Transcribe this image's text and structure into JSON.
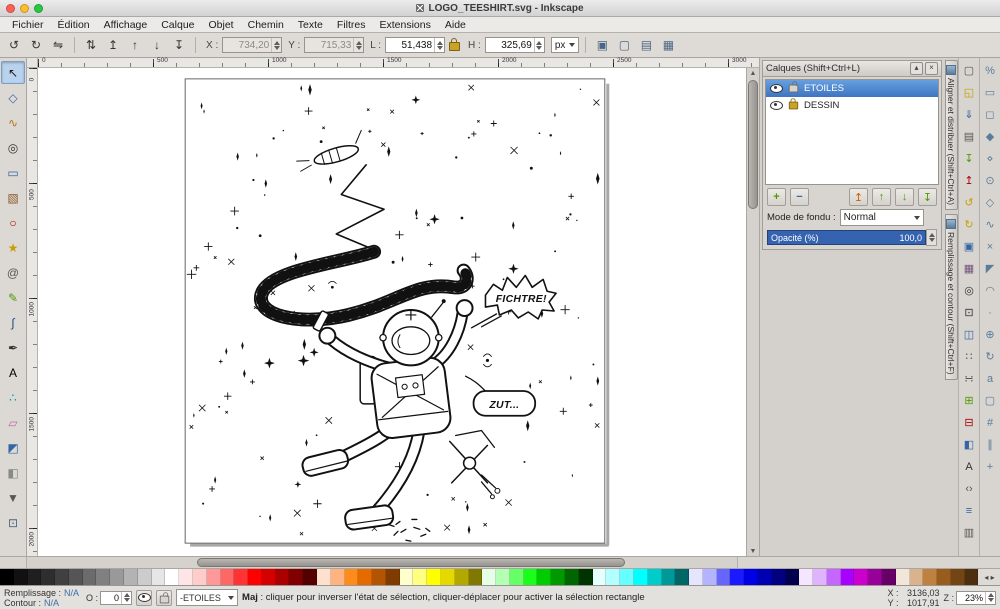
{
  "window": {
    "title": "LOGO_TEESHIRT.svg - Inkscape"
  },
  "menubar": {
    "items": [
      "Fichier",
      "Édition",
      "Affichage",
      "Calque",
      "Objet",
      "Chemin",
      "Texte",
      "Filtres",
      "Extensions",
      "Aide"
    ]
  },
  "tool_options": {
    "history_buttons": [
      {
        "name": "rotate-90-ccw-button",
        "glyph": "↺"
      },
      {
        "name": "rotate-90-cw-button",
        "glyph": "↻"
      },
      {
        "name": "flip-horizontal-button",
        "glyph": "⇋"
      }
    ],
    "arrange_buttons": [
      {
        "name": "flip-vertical-button",
        "glyph": "⇅"
      },
      {
        "name": "raise-to-top-button",
        "glyph": "↥"
      },
      {
        "name": "raise-button",
        "glyph": "↑"
      },
      {
        "name": "lower-button",
        "glyph": "↓"
      },
      {
        "name": "lower-to-bottom-button",
        "glyph": "↧"
      }
    ],
    "x_label": "X :",
    "x_value": "734,20",
    "y_label": "Y :",
    "y_value": "715,33",
    "w_label": "L :",
    "w_value": "51,438",
    "h_label": "H :",
    "h_value": "325,69",
    "unit": "px",
    "affect_buttons": [
      {
        "name": "transform-stroke-toggle",
        "glyph": "▣"
      },
      {
        "name": "transform-corners-toggle",
        "glyph": "▢"
      },
      {
        "name": "transform-gradient-toggle",
        "glyph": "▤"
      },
      {
        "name": "transform-pattern-toggle",
        "glyph": "▦"
      }
    ]
  },
  "toolbox": {
    "tools": [
      {
        "name": "selector-tool",
        "glyph": "↖",
        "color": "#1a1a1a",
        "active": true
      },
      {
        "name": "node-tool",
        "glyph": "◇",
        "color": "#3465a4",
        "active": false
      },
      {
        "name": "tweak-tool",
        "glyph": "∿",
        "color": "#b57614",
        "active": false
      },
      {
        "name": "zoom-tool",
        "glyph": "◎",
        "color": "#333333",
        "active": false
      },
      {
        "name": "rectangle-tool",
        "glyph": "▭",
        "color": "#3465a4",
        "active": false
      },
      {
        "name": "box3d-tool",
        "glyph": "▧",
        "color": "#8a5a2a",
        "active": false
      },
      {
        "name": "ellipse-tool",
        "glyph": "○",
        "color": "#a40000",
        "active": false
      },
      {
        "name": "star-tool",
        "glyph": "★",
        "color": "#c4a000",
        "active": false
      },
      {
        "name": "spiral-tool",
        "glyph": "@",
        "color": "#555753",
        "active": false
      },
      {
        "name": "pencil-tool",
        "glyph": "✎",
        "color": "#4e9a06",
        "active": false
      },
      {
        "name": "bezier-pen-tool",
        "glyph": "∫",
        "color": "#204a87",
        "active": false
      },
      {
        "name": "calligraphy-tool",
        "glyph": "✒",
        "color": "#2e3436",
        "active": false
      },
      {
        "name": "text-tool",
        "glyph": "A",
        "color": "#000000",
        "active": false
      },
      {
        "name": "spray-tool",
        "glyph": "∴",
        "color": "#06989a",
        "active": false
      },
      {
        "name": "eraser-tool",
        "glyph": "▱",
        "color": "#c4699c",
        "active": false
      },
      {
        "name": "paint-bucket-tool",
        "glyph": "◩",
        "color": "#3465a4",
        "active": false
      },
      {
        "name": "gradient-tool",
        "glyph": "◧",
        "color": "#888a85",
        "active": false
      },
      {
        "name": "dropper-tool",
        "glyph": "▼",
        "color": "#555753",
        "active": false
      },
      {
        "name": "connector-tool",
        "glyph": "⊡",
        "color": "#4a6785",
        "active": false
      }
    ]
  },
  "rulers": {
    "top": [
      "0",
      "500",
      "1000",
      "1500",
      "2000",
      "2500",
      "3000"
    ],
    "left": [
      "0",
      "500",
      "1000",
      "1500",
      "2000"
    ]
  },
  "canvas": {
    "bubble_fichtre": "FICHTRE!",
    "bubble_zut": "ZUT..."
  },
  "layers_panel": {
    "title": "Calques (Shift+Ctrl+L)",
    "rows": [
      {
        "name": "ETOILES",
        "selected": true,
        "locked": false,
        "visible": true
      },
      {
        "name": "DESSIN",
        "selected": false,
        "locked": true,
        "visible": true
      }
    ],
    "add_label": "+",
    "remove_label": "−",
    "blend_label": "Mode de fondu :",
    "blend_value": "Normal",
    "opacity_label": "Opacité (%)",
    "opacity_value": "100,0"
  },
  "dock_tabs": [
    {
      "name": "align-distribute-dialog-tab",
      "label": "Aligner et distribuer (Shift+Ctrl+A)"
    },
    {
      "name": "fill-stroke-dialog-tab",
      "label": "Remplissage et contour (Shift+Ctrl+F)"
    }
  ],
  "right_commands": [
    {
      "name": "new-document-button",
      "glyph": "▢",
      "color": "#555753"
    },
    {
      "name": "open-document-button",
      "glyph": "◱",
      "color": "#c4a000"
    },
    {
      "name": "save-document-button",
      "glyph": "⇓",
      "color": "#3465a4"
    },
    {
      "name": "print-button",
      "glyph": "▤",
      "color": "#555753"
    },
    {
      "name": "import-button",
      "glyph": "↧",
      "color": "#4e9a06"
    },
    {
      "name": "export-button",
      "glyph": "↥",
      "color": "#a40000"
    },
    {
      "name": "undo-button",
      "glyph": "↺",
      "color": "#c4a000"
    },
    {
      "name": "redo-button",
      "glyph": "↻",
      "color": "#c4a000"
    },
    {
      "name": "copy-button",
      "glyph": "▣",
      "color": "#3465a4"
    },
    {
      "name": "paste-button",
      "glyph": "▦",
      "color": "#75507b"
    },
    {
      "name": "zoom-drawing-button",
      "glyph": "◎",
      "color": "#2e3436"
    },
    {
      "name": "zoom-page-button",
      "glyph": "⊡",
      "color": "#2e3436"
    },
    {
      "name": "duplicate-button",
      "glyph": "◫",
      "color": "#3465a4"
    },
    {
      "name": "create-clone-button",
      "glyph": "∷",
      "color": "#555753"
    },
    {
      "name": "unlink-clone-button",
      "glyph": "∺",
      "color": "#555753"
    },
    {
      "name": "group-button",
      "glyph": "⊞",
      "color": "#4e9a06"
    },
    {
      "name": "ungroup-button",
      "glyph": "⊟",
      "color": "#a40000"
    },
    {
      "name": "fill-stroke-dialog-button",
      "glyph": "◧",
      "color": "#3465a4"
    },
    {
      "name": "text-dialog-button",
      "glyph": "A",
      "color": "#2e3436"
    },
    {
      "name": "xml-editor-button",
      "glyph": "‹›",
      "color": "#555753"
    },
    {
      "name": "align-dialog-button",
      "glyph": "≡",
      "color": "#3465a4"
    },
    {
      "name": "document-properties-button",
      "glyph": "▥",
      "color": "#555753"
    }
  ],
  "snap_bar": [
    {
      "name": "snap-enable-toggle",
      "glyph": "%"
    },
    {
      "name": "snap-bbox-toggle",
      "glyph": "▭"
    },
    {
      "name": "snap-bbox-edges-toggle",
      "glyph": "◻"
    },
    {
      "name": "snap-bbox-corners-toggle",
      "glyph": "◆"
    },
    {
      "name": "snap-bbox-edge-midpoints-toggle",
      "glyph": "⋄"
    },
    {
      "name": "snap-bbox-centers-toggle",
      "glyph": "⊙"
    },
    {
      "name": "snap-nodes-toggle",
      "glyph": "◇"
    },
    {
      "name": "snap-paths-toggle",
      "glyph": "∿"
    },
    {
      "name": "snap-path-intersections-toggle",
      "glyph": "×"
    },
    {
      "name": "snap-cusp-nodes-toggle",
      "glyph": "◤"
    },
    {
      "name": "snap-smooth-nodes-toggle",
      "glyph": "◠"
    },
    {
      "name": "snap-line-midpoints-toggle",
      "glyph": "·"
    },
    {
      "name": "snap-object-centers-toggle",
      "glyph": "⊕"
    },
    {
      "name": "snap-rotation-centers-toggle",
      "glyph": "↻"
    },
    {
      "name": "snap-text-baseline-toggle",
      "glyph": "a"
    },
    {
      "name": "snap-page-border-toggle",
      "glyph": "▢"
    },
    {
      "name": "snap-grid-toggle",
      "glyph": "#"
    },
    {
      "name": "snap-guides-toggle",
      "glyph": "∥"
    },
    {
      "name": "snap-guide-intersections-toggle",
      "glyph": "+"
    }
  ],
  "palette": {
    "colors": [
      "#000000",
      "#111111",
      "#1f1f1f",
      "#2e2e2e",
      "#404040",
      "#555555",
      "#6b6b6b",
      "#808080",
      "#999999",
      "#b3b3b3",
      "#cccccc",
      "#e6e6e6",
      "#ffffff",
      "#ffe5e5",
      "#ffcccc",
      "#ff9999",
      "#ff6666",
      "#ff3333",
      "#ff0000",
      "#d40000",
      "#aa0000",
      "#800000",
      "#550000",
      "#ffe0cc",
      "#ffb380",
      "#ff8c1a",
      "#e56b00",
      "#b35400",
      "#803c00",
      "#ffffcc",
      "#ffff80",
      "#ffff00",
      "#e6d900",
      "#b3a800",
      "#807800",
      "#e5ffe5",
      "#b3ffb3",
      "#66ff66",
      "#1aff1a",
      "#00cc00",
      "#009900",
      "#006600",
      "#003300",
      "#e5ffff",
      "#b3ffff",
      "#66ffff",
      "#00ffff",
      "#00cccc",
      "#009999",
      "#006666",
      "#e5e5ff",
      "#b3b3ff",
      "#6666ff",
      "#1a1aff",
      "#0000e6",
      "#0000b3",
      "#000080",
      "#00004d",
      "#f5e5ff",
      "#e0b3ff",
      "#c466ff",
      "#aa00ff",
      "#cc00cc",
      "#990099",
      "#660066",
      "#f2e6d9",
      "#d9b38c",
      "#bf8040",
      "#995c1f",
      "#734515",
      "#4d2e0e"
    ]
  },
  "statusbar": {
    "fill_label": "Remplissage :",
    "fill_value": "N/A",
    "stroke_label": "Contour :",
    "stroke_value": "N/A",
    "opacity_label": "O :",
    "opacity_value": "0",
    "layer_select": "-ETOILES",
    "hint_bold": "Maj",
    "hint_rest": " : cliquer pour inverser l'état de sélection, cliquer-déplacer pour activer la sélection rectangle",
    "x_label": "X :",
    "x_value": "3136,03",
    "y_label": "Y :",
    "y_value": "1017,91",
    "zoom_label": "Z :",
    "zoom_value": "23%"
  }
}
